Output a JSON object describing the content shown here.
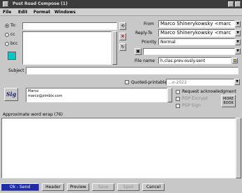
{
  "window": {
    "title": "Post Road Compose (1)"
  },
  "menu": [
    "File",
    "Edit",
    "Format",
    "Windows"
  ],
  "recipients": {
    "to_label": "To:",
    "cc_label": "cc",
    "bcc_label": "bcc"
  },
  "header": {
    "from_label": "From",
    "from_value": "Marco Shinerykowsky <marc",
    "replyto_label": "Reply-To",
    "replyto_value": "Marco Shinerykowsky <marc",
    "priority_label": "Priority",
    "priority_value": "Normal",
    "filename_label": "File name",
    "filename_value": "h.clas.prev.ously.sent"
  },
  "subject": {
    "label": "Subject",
    "value": ""
  },
  "encoding": {
    "quoted_printable_label": "Quoted-printable",
    "charset_value": "...o-2022"
  },
  "signature": {
    "icon_label": "Sig",
    "text_line1": "Marco",
    "text_line2": "marco@zimbix.com"
  },
  "options": {
    "request_ack": "Request acknowledgment",
    "pgp_encrypt": "PGP Encrypt",
    "pgp_sign": "PGP Sign",
    "more_line1": "MORE",
    "more_line2": "BOOK"
  },
  "body": {
    "wrap_label": "Approximate word wrap (76)"
  },
  "buttons": {
    "send": "Ok - Send",
    "header": "Header",
    "preview": "Preview",
    "save": "Save",
    "spell": "Spell",
    "cancel": "Cancel"
  },
  "colors": {
    "accent_teal": "#00c8c8",
    "send_button": "#1e2ca8"
  }
}
